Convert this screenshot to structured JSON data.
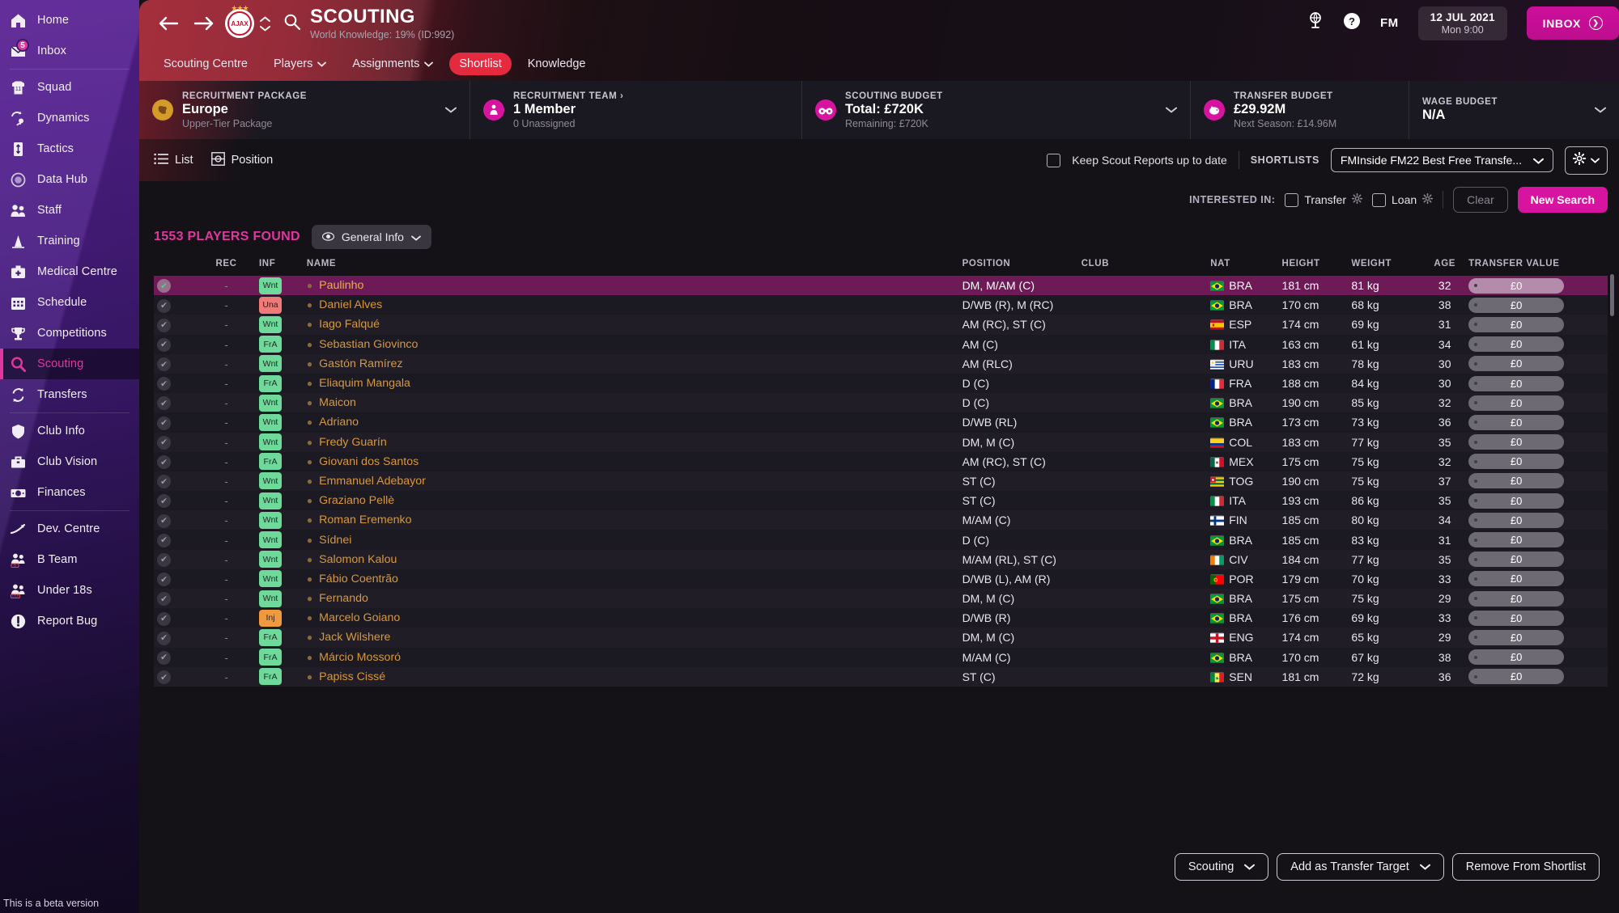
{
  "sidebar": {
    "items": [
      {
        "label": "Home",
        "icon": "home-icon",
        "badge": null
      },
      {
        "label": "Inbox",
        "icon": "inbox-icon",
        "badge": "5"
      },
      {
        "label": "Squad",
        "icon": "shirt-icon",
        "badge": null
      },
      {
        "label": "Dynamics",
        "icon": "dynamics-icon",
        "badge": null
      },
      {
        "label": "Tactics",
        "icon": "tactics-icon",
        "badge": null
      },
      {
        "label": "Data Hub",
        "icon": "datahub-icon",
        "badge": null
      },
      {
        "label": "Staff",
        "icon": "staff-icon",
        "badge": null
      },
      {
        "label": "Training",
        "icon": "training-icon",
        "badge": null
      },
      {
        "label": "Medical Centre",
        "icon": "medical-icon",
        "badge": null
      },
      {
        "label": "Schedule",
        "icon": "calendar-icon",
        "badge": null
      },
      {
        "label": "Competitions",
        "icon": "trophy-icon",
        "badge": null
      },
      {
        "label": "Scouting",
        "icon": "magnifier-icon",
        "badge": null
      },
      {
        "label": "Transfers",
        "icon": "transfers-icon",
        "badge": null
      },
      {
        "label": "Club Info",
        "icon": "shield-icon",
        "badge": null
      },
      {
        "label": "Club Vision",
        "icon": "briefcase-icon",
        "badge": null
      },
      {
        "label": "Finances",
        "icon": "money-icon",
        "badge": null
      },
      {
        "label": "Dev. Centre",
        "icon": "growth-icon",
        "badge": null
      },
      {
        "label": "B Team",
        "icon": "bteam-icon",
        "badge": null
      },
      {
        "label": "Under 18s",
        "icon": "u18-icon",
        "badge": null
      },
      {
        "label": "Report Bug",
        "icon": "exclamation-icon",
        "badge": null
      }
    ],
    "active_label": "Scouting",
    "beta_note": "This is a beta version"
  },
  "header": {
    "title": "SCOUTING",
    "subtitle": "World Knowledge: 19% (ID:992)",
    "fm_logo": "FM",
    "date_line1": "12 JUL 2021",
    "date_line2": "Mon 9:00",
    "inbox_label": "INBOX",
    "tabs": [
      {
        "label": "Scouting Centre",
        "selected": false,
        "dropdown": false
      },
      {
        "label": "Players",
        "selected": false,
        "dropdown": true
      },
      {
        "label": "Assignments",
        "selected": false,
        "dropdown": true
      },
      {
        "label": "Shortlist",
        "selected": true,
        "dropdown": false
      },
      {
        "label": "Knowledge",
        "selected": false,
        "dropdown": false
      }
    ]
  },
  "budget_strip": [
    {
      "label": "RECRUITMENT PACKAGE",
      "main": "Europe",
      "sub": "Upper-Tier Package",
      "icon": "europe-icon",
      "chevron": true,
      "icon_color": "#d49a2a"
    },
    {
      "label": "RECRUITMENT TEAM ›",
      "main": "1 Member",
      "sub": "0 Unassigned",
      "icon": "team-icon",
      "chevron": false,
      "icon_color": "#d714a0"
    },
    {
      "label": "SCOUTING BUDGET",
      "main": "Total: £720K",
      "sub": "Remaining: £720K",
      "icon": "binoculars-icon",
      "chevron": true,
      "icon_color": "#d714a0"
    },
    {
      "label": "TRANSFER BUDGET",
      "main": "£29.92M",
      "sub": "Next Season: £14.96M",
      "icon": "piggy-icon",
      "chevron": false,
      "icon_color": "#d714a0"
    },
    {
      "label": "WAGE BUDGET",
      "main": "N/A",
      "sub": "",
      "icon": null,
      "chevron": true,
      "icon_color": "#d714a0"
    }
  ],
  "view_bar": {
    "list_label": "List",
    "position_label": "Position",
    "keep_reports_label": "Keep Scout Reports up to date",
    "keep_reports_checked": false,
    "shortlists_label": "SHORTLISTS",
    "shortlist_selected": "FMInside FM22 Best Free Transfe...",
    "gear_label": "gear-icon"
  },
  "interested": {
    "prefix": "INTERESTED IN:",
    "transfer_label": "Transfer",
    "transfer_checked": false,
    "loan_label": "Loan",
    "loan_checked": false,
    "clear_label": "Clear",
    "new_search_label": "New Search"
  },
  "results": {
    "count_label": "1553 PLAYERS FOUND",
    "view_pill": "General Info",
    "columns": [
      "",
      "REC",
      "INF",
      "NAME",
      "POSITION",
      "CLUB",
      "NAT",
      "HEIGHT",
      "WEIGHT",
      "AGE",
      "TRANSFER VALUE"
    ],
    "rows": [
      {
        "selected": true,
        "rec": "-",
        "inf": "Wnt",
        "name": "Paulinho",
        "position": "DM, M/AM (C)",
        "club": "",
        "nat": "BRA",
        "height": "181 cm",
        "weight": "81 kg",
        "age": "32",
        "value": "£0"
      },
      {
        "selected": false,
        "rec": "-",
        "inf": "Una",
        "name": "Daniel Alves",
        "position": "D/WB (R), M (RC)",
        "club": "",
        "nat": "BRA",
        "height": "170 cm",
        "weight": "68 kg",
        "age": "38",
        "value": "£0"
      },
      {
        "selected": false,
        "rec": "-",
        "inf": "Wnt",
        "name": "Iago Falqué",
        "position": "AM (RC), ST (C)",
        "club": "",
        "nat": "ESP",
        "height": "174 cm",
        "weight": "69 kg",
        "age": "31",
        "value": "£0"
      },
      {
        "selected": false,
        "rec": "-",
        "inf": "FrA",
        "name": "Sebastian Giovinco",
        "position": "AM (C)",
        "club": "",
        "nat": "ITA",
        "height": "163 cm",
        "weight": "61 kg",
        "age": "34",
        "value": "£0"
      },
      {
        "selected": false,
        "rec": "-",
        "inf": "Wnt",
        "name": "Gastón Ramírez",
        "position": "AM (RLC)",
        "club": "",
        "nat": "URU",
        "height": "183 cm",
        "weight": "78 kg",
        "age": "30",
        "value": "£0"
      },
      {
        "selected": false,
        "rec": "-",
        "inf": "FrA",
        "name": "Eliaquim Mangala",
        "position": "D (C)",
        "club": "",
        "nat": "FRA",
        "height": "188 cm",
        "weight": "84 kg",
        "age": "30",
        "value": "£0"
      },
      {
        "selected": false,
        "rec": "-",
        "inf": "Wnt",
        "name": "Maicon",
        "position": "D (C)",
        "club": "",
        "nat": "BRA",
        "height": "190 cm",
        "weight": "85 kg",
        "age": "32",
        "value": "£0"
      },
      {
        "selected": false,
        "rec": "-",
        "inf": "Wnt",
        "name": "Adriano",
        "position": "D/WB (RL)",
        "club": "",
        "nat": "BRA",
        "height": "173 cm",
        "weight": "73 kg",
        "age": "36",
        "value": "£0"
      },
      {
        "selected": false,
        "rec": "-",
        "inf": "Wnt",
        "name": "Fredy Guarín",
        "position": "DM, M (C)",
        "club": "",
        "nat": "COL",
        "height": "183 cm",
        "weight": "77 kg",
        "age": "35",
        "value": "£0"
      },
      {
        "selected": false,
        "rec": "-",
        "inf": "FrA",
        "name": "Giovani dos Santos",
        "position": "AM (RC), ST (C)",
        "club": "",
        "nat": "MEX",
        "height": "175 cm",
        "weight": "75 kg",
        "age": "32",
        "value": "£0"
      },
      {
        "selected": false,
        "rec": "-",
        "inf": "Wnt",
        "name": "Emmanuel Adebayor",
        "position": "ST (C)",
        "club": "",
        "nat": "TOG",
        "height": "190 cm",
        "weight": "75 kg",
        "age": "37",
        "value": "£0"
      },
      {
        "selected": false,
        "rec": "-",
        "inf": "Wnt",
        "name": "Graziano Pellè",
        "position": "ST (C)",
        "club": "",
        "nat": "ITA",
        "height": "193 cm",
        "weight": "86 kg",
        "age": "35",
        "value": "£0"
      },
      {
        "selected": false,
        "rec": "-",
        "inf": "Wnt",
        "name": "Roman Eremenko",
        "position": "M/AM (C)",
        "club": "",
        "nat": "FIN",
        "height": "185 cm",
        "weight": "80 kg",
        "age": "34",
        "value": "£0"
      },
      {
        "selected": false,
        "rec": "-",
        "inf": "Wnt",
        "name": "Sídnei",
        "position": "D (C)",
        "club": "",
        "nat": "BRA",
        "height": "185 cm",
        "weight": "83 kg",
        "age": "31",
        "value": "£0"
      },
      {
        "selected": false,
        "rec": "-",
        "inf": "Wnt",
        "name": "Salomon Kalou",
        "position": "M/AM (RL), ST (C)",
        "club": "",
        "nat": "CIV",
        "height": "184 cm",
        "weight": "77 kg",
        "age": "35",
        "value": "£0"
      },
      {
        "selected": false,
        "rec": "-",
        "inf": "Wnt",
        "name": "Fábio Coentrão",
        "position": "D/WB (L), AM (R)",
        "club": "",
        "nat": "POR",
        "height": "179 cm",
        "weight": "70 kg",
        "age": "33",
        "value": "£0"
      },
      {
        "selected": false,
        "rec": "-",
        "inf": "Wnt",
        "name": "Fernando",
        "position": "DM, M (C)",
        "club": "",
        "nat": "BRA",
        "height": "175 cm",
        "weight": "75 kg",
        "age": "29",
        "value": "£0"
      },
      {
        "selected": false,
        "rec": "-",
        "inf": "Inj",
        "name": "Marcelo Goiano",
        "position": "D/WB (R)",
        "club": "",
        "nat": "BRA",
        "height": "176 cm",
        "weight": "69 kg",
        "age": "33",
        "value": "£0"
      },
      {
        "selected": false,
        "rec": "-",
        "inf": "FrA",
        "name": "Jack Wilshere",
        "position": "DM, M (C)",
        "club": "",
        "nat": "ENG",
        "height": "174 cm",
        "weight": "65 kg",
        "age": "29",
        "value": "£0"
      },
      {
        "selected": false,
        "rec": "-",
        "inf": "FrA",
        "name": "Márcio Mossoró",
        "position": "M/AM (C)",
        "club": "",
        "nat": "BRA",
        "height": "170 cm",
        "weight": "67 kg",
        "age": "38",
        "value": "£0"
      },
      {
        "selected": false,
        "rec": "-",
        "inf": "FrA",
        "name": "Papiss Cissé",
        "position": "ST (C)",
        "club": "",
        "nat": "SEN",
        "height": "181 cm",
        "weight": "72 kg",
        "age": "36",
        "value": "£0"
      }
    ]
  },
  "bottom_bar": {
    "scouting_label": "Scouting",
    "add_transfer_label": "Add as Transfer Target",
    "remove_label": "Remove From Shortlist"
  },
  "colors": {
    "accent_pink": "#e0379f",
    "tab_selected": "#e5293f",
    "selected_row": "#6d1a57",
    "name_orange": "#d8983a",
    "inf_green": "#6ed99a",
    "inf_red": "#ef7a7a",
    "inf_orange": "#ef9a3e"
  }
}
